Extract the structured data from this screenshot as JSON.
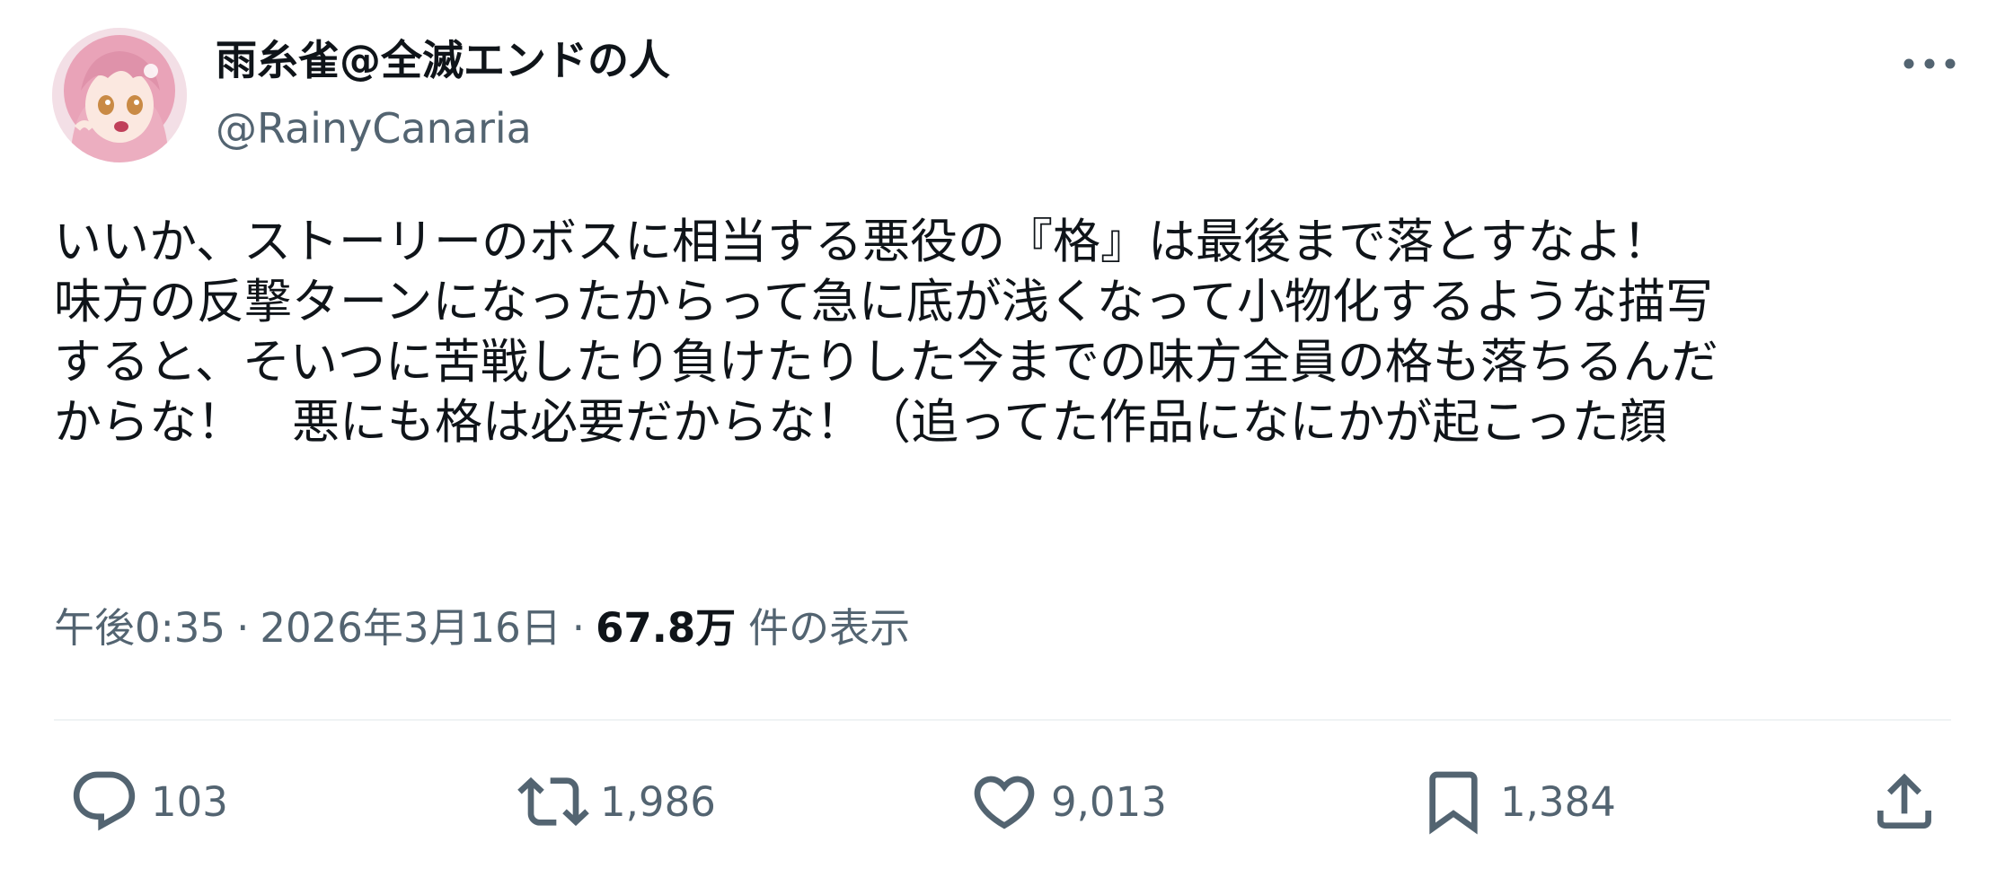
{
  "author": {
    "display_name": "雨糸雀@全滅エンドの人",
    "handle": "@RainyCanaria"
  },
  "tweet": {
    "lines": [
      "いいか、ストーリーのボスに相当する悪役の『格』は最後まで落とすなよ！",
      "味方の反撃ターンになったからって急に底が浅くなって小物化するような描写",
      "すると、そいつに苦戦したり負けたりした今までの味方全員の格も落ちるんだ",
      "からな！　悪にも格は必要だからな！（追ってた作品になにかが起こった顔"
    ]
  },
  "meta": {
    "time": "午後0:35",
    "separator": "·",
    "date": "2026年3月16日",
    "views_count": "67.8万",
    "views_label": "件の表示"
  },
  "actions": {
    "reply": {
      "icon": "reply-icon",
      "count": "103"
    },
    "retweet": {
      "icon": "retweet-icon",
      "count": "1,986"
    },
    "like": {
      "icon": "heart-icon",
      "count": "9,013"
    },
    "bookmark": {
      "icon": "bookmark-icon",
      "count": "1,384"
    },
    "share": {
      "icon": "share-icon"
    },
    "more": {
      "icon": "more-horizontal-icon"
    }
  },
  "colors": {
    "text_primary": "#0f1419",
    "text_secondary": "#536471",
    "divider": "#eff3f4",
    "avatar_hair": "#e9a3b8"
  }
}
